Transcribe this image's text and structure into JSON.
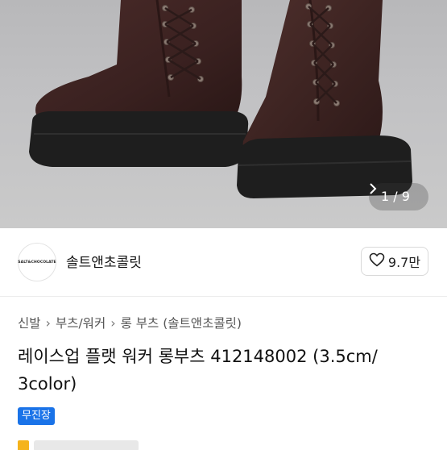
{
  "gallery": {
    "pager_current": "1",
    "pager_sep": "/",
    "pager_total": "9",
    "image_alt": "brown lace-up flat worker long boots"
  },
  "seller": {
    "logo_text": "SALT&CHOCOLATE",
    "name": "솔트앤초콜릿",
    "like_count": "9.7만"
  },
  "breadcrumb": [
    "신발",
    "부츠/워커",
    "롱 부츠 (솔트앤초콜릿)"
  ],
  "product": {
    "title": "레이스업 플랫 워커 롱부츠 412148002 (3.5cm/ 3color)",
    "badge": "무진장"
  },
  "colors": {
    "badge_bg": "#1a73e8",
    "boot_leather": "#3d2322",
    "sole": "#1e1e1e"
  }
}
